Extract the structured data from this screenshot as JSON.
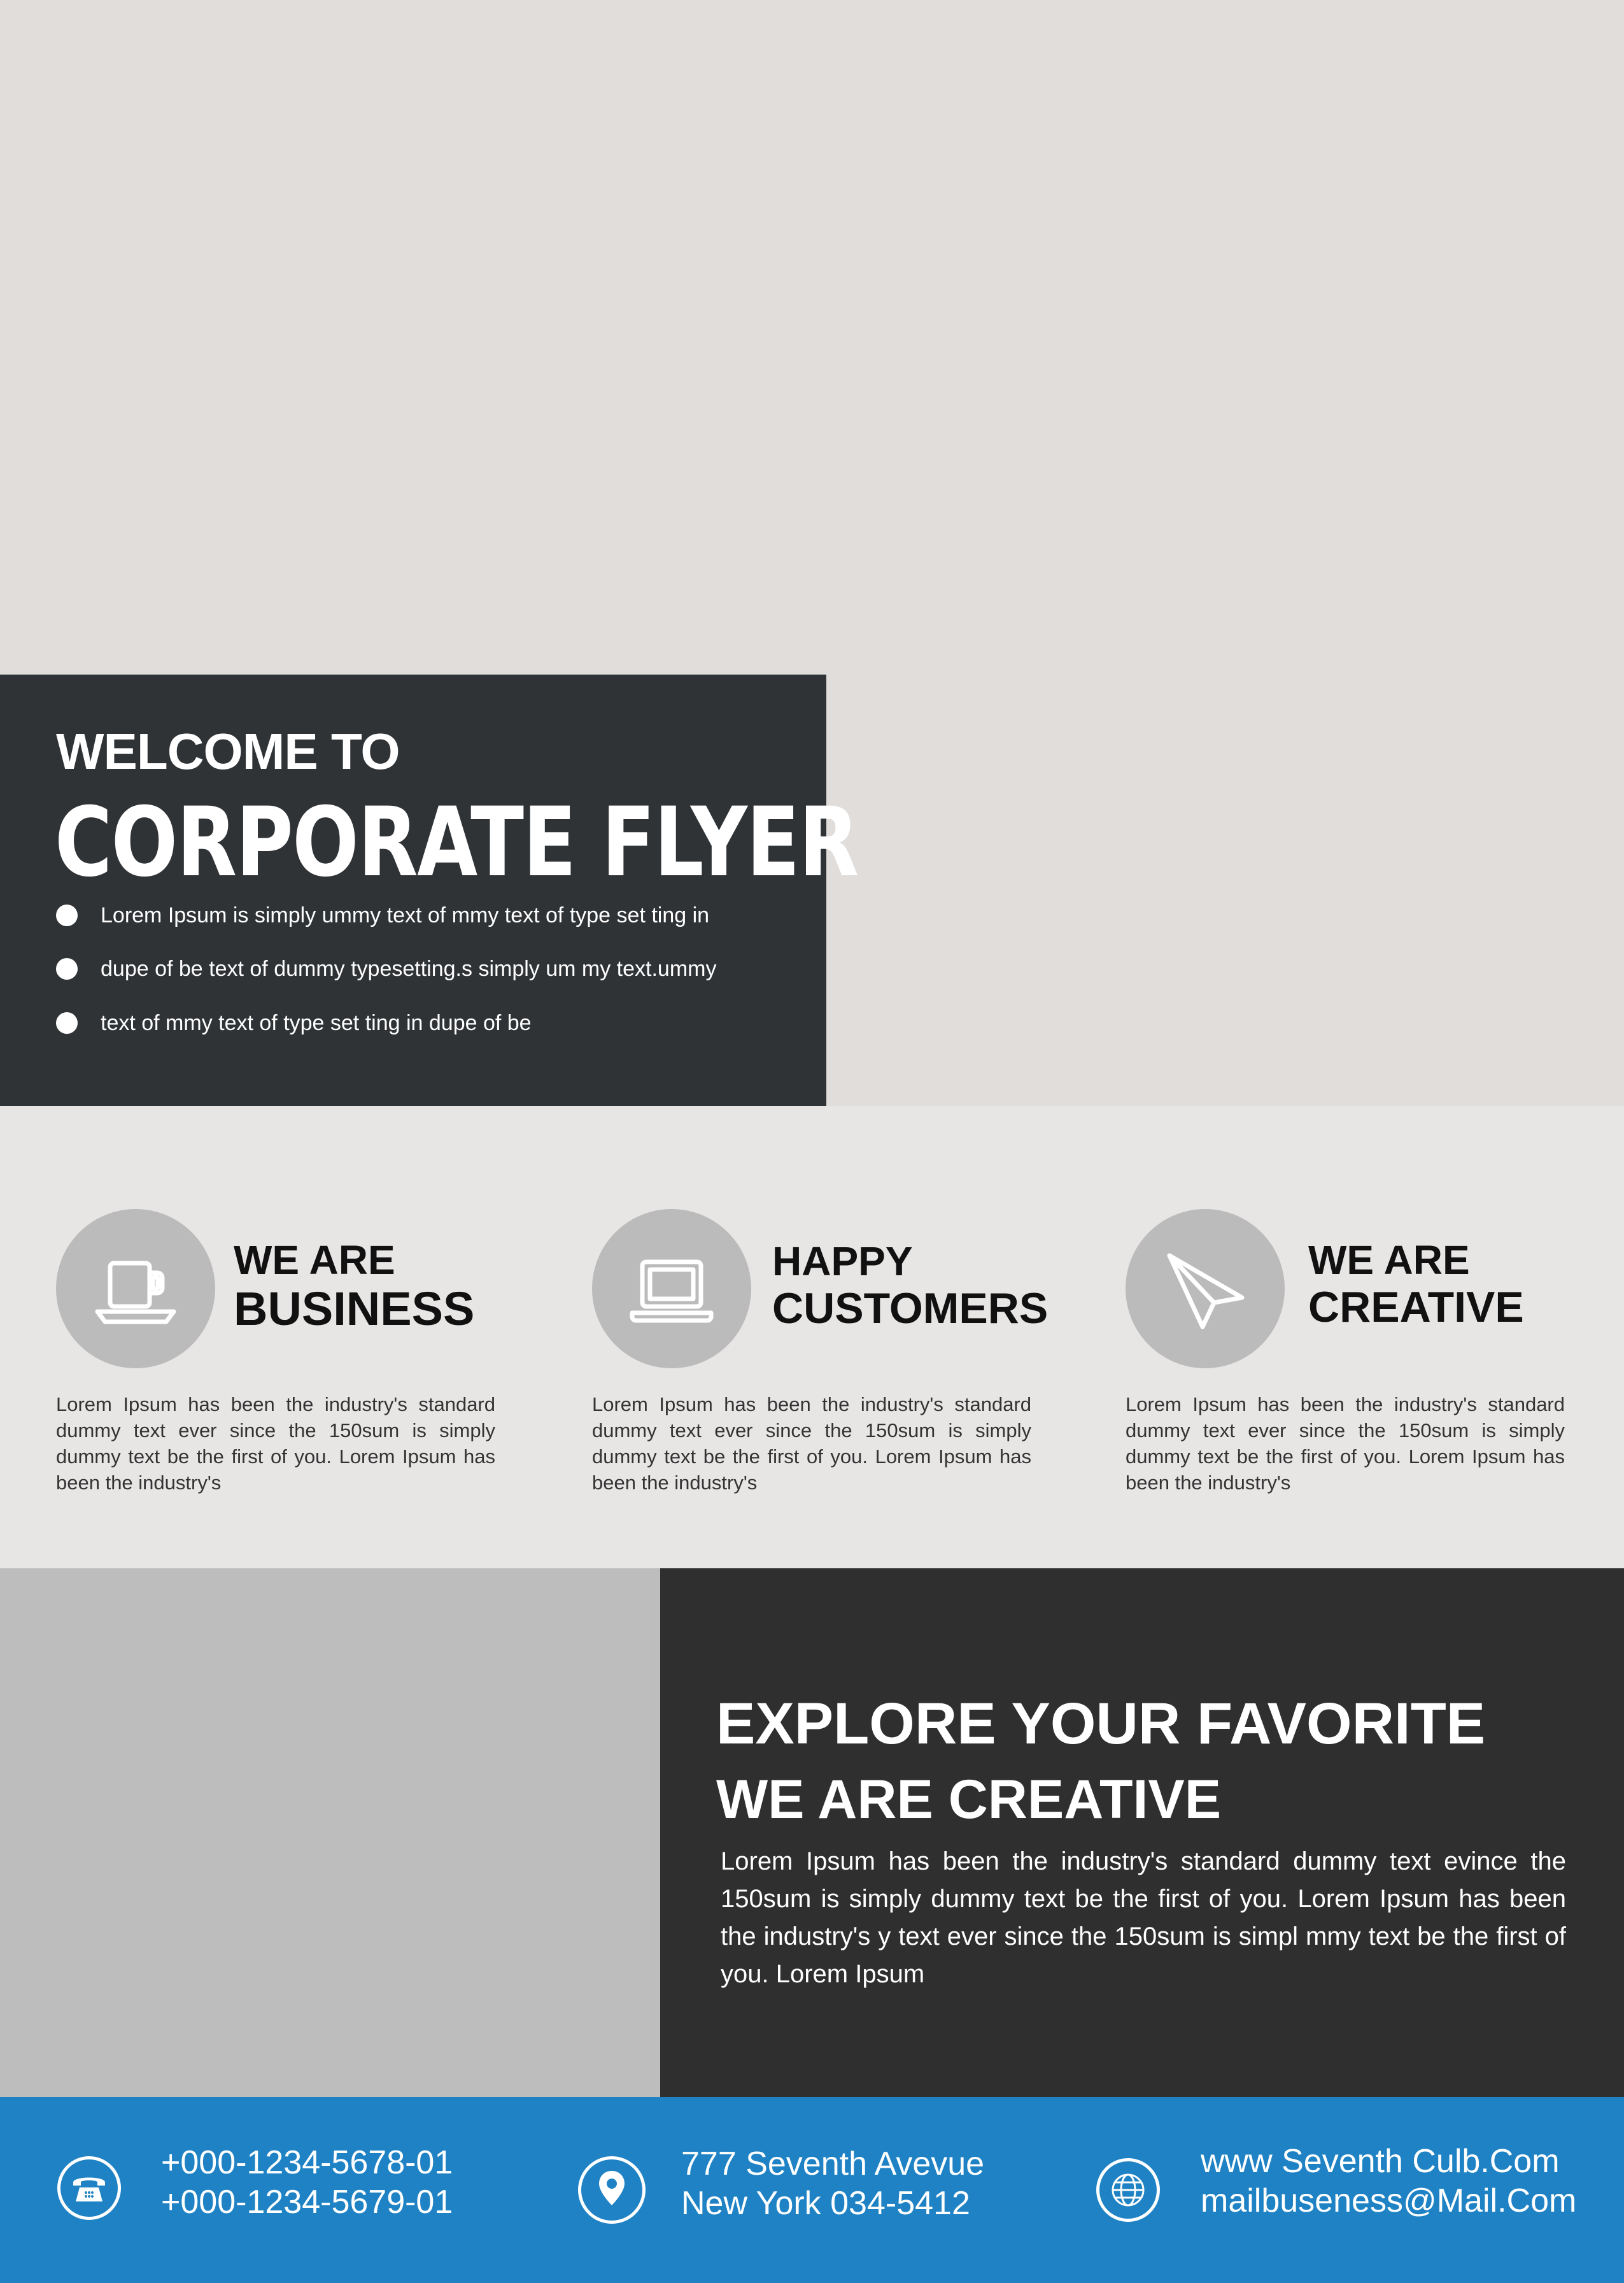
{
  "hero": {
    "welcome": "WELCOME TO",
    "title": "CORPORATE FLYER",
    "bullets": [
      "Lorem Ipsum is simply ummy text of mmy text of type set ting in",
      "dupe of be text of dummy typesetting.s simply um my text.ummy",
      "text of mmy text of type set ting in dupe of be"
    ]
  },
  "features": [
    {
      "title_line1": "WE ARE",
      "title_line2": "BUSINESS",
      "icon": "coffee-cup-icon",
      "body": "Lorem Ipsum has been the industry's standard dummy text ever since the 150sum is simply dummy text be the first of you. Lorem Ipsum has been the industry's"
    },
    {
      "title_line1": "HAPPY",
      "title_line2": "CUSTOMERS",
      "icon": "laptop-icon",
      "body": "Lorem Ipsum has been the industry's standard dummy text ever since the 150sum is simply dummy text be the first of you. Lorem Ipsum has been the industry's"
    },
    {
      "title_line1": "WE ARE",
      "title_line2": "CREATIVE",
      "icon": "paper-plane-icon",
      "body": "Lorem Ipsum has been the industry's standard dummy text ever since the 150sum is simply dummy text be the first of you. Lorem Ipsum has been the industry's"
    }
  ],
  "explore": {
    "heading1": "EXPLORE YOUR FAVORITE",
    "heading2": "WE ARE CREATIVE",
    "body": "Lorem Ipsum has been the industry's standard dummy text evince the 150sum is simply dummy text be the first of you. Lorem Ipsum has been the industry's  y text ever since the 150sum is simpl mmy text be the first of you. Lorem Ipsum"
  },
  "footer": {
    "phone1": "+000-1234-5678-01",
    "phone2": "+000-1234-5679-01",
    "address1": "777 Seventh Avevue",
    "address2": "New York 034-5412",
    "web": "www Seventh Culb.Com",
    "email": "mailbuseness@Mail.Com",
    "icons": [
      "telephone-icon",
      "location-pin-icon",
      "globe-icon"
    ]
  },
  "colors": {
    "dark_panel": "#303336",
    "footer_blue": "#1e82c4",
    "photo_placeholder": "#e0dddb"
  }
}
